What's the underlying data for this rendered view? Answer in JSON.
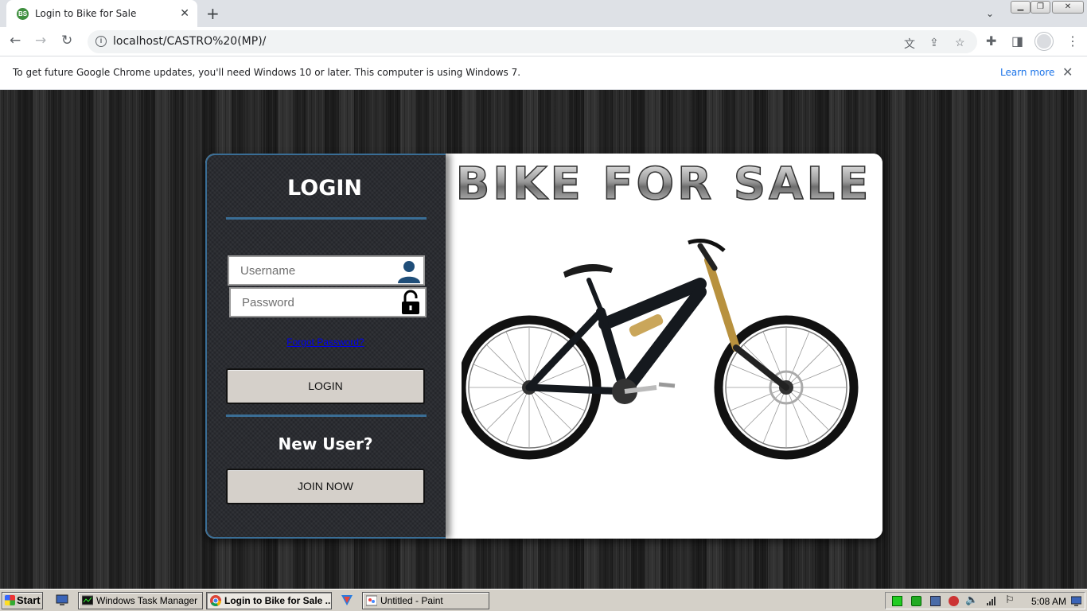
{
  "browser": {
    "tab_title": "Login to Bike for Sale",
    "url": "localhost/CASTRO%20(MP)/"
  },
  "infobar": {
    "message": "To get future Google Chrome updates, you'll need Windows 10 or later. This computer is using Windows 7.",
    "learn_more": "Learn more"
  },
  "login_panel": {
    "title": "LOGIN",
    "username_placeholder": "Username",
    "password_placeholder": "Password",
    "forgot_link": "Forgot Password?",
    "login_button": "LOGIN",
    "new_user_heading": "New User?",
    "join_button": "JOIN NOW"
  },
  "brand": {
    "logo_text": "BIKE FOR SALE"
  },
  "taskbar": {
    "start_label": "Start",
    "tasks": [
      {
        "label": "Windows Task Manager",
        "active": false
      },
      {
        "label": "Login to Bike for Sale ...",
        "active": true
      },
      {
        "label": "Untitled - Paint",
        "active": false
      }
    ],
    "clock": "5:08 AM"
  },
  "colors": {
    "panel_accent": "#3a6e96",
    "button_bg": "#d5d0ca",
    "link": "#0000ee"
  }
}
